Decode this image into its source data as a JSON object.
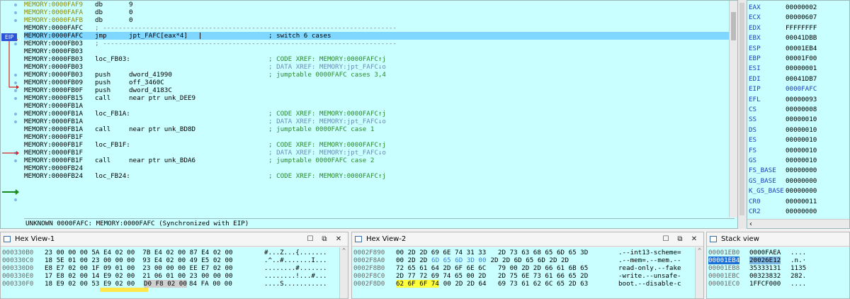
{
  "disasm": {
    "eip_tag": "EIP",
    "lines": [
      {
        "addr": "MEMORY:0000FAF9",
        "kind": "data",
        "mn": "db",
        "op": "9"
      },
      {
        "addr": "MEMORY:0000FAFA",
        "kind": "data",
        "mn": "db",
        "op": "0"
      },
      {
        "addr": "MEMORY:0000FAFB",
        "kind": "data",
        "mn": "db",
        "op": "0"
      },
      {
        "addr": "MEMORY:0000FAFC",
        "kind": "sep",
        "op": "; ---------------------------------------------------------------------------"
      },
      {
        "addr": "MEMORY:0000FAFC",
        "kind": "current",
        "mn": "jmp",
        "op": "jpt_FAFC[eax*4]",
        "cm": "; switch 6 cases",
        "cmkind": "plain"
      },
      {
        "addr": "MEMORY:0000FB03",
        "kind": "sep",
        "op": "; ---------------------------------------------------------------------------"
      },
      {
        "addr": "MEMORY:0000FB03",
        "kind": "blank"
      },
      {
        "addr": "MEMORY:0000FB03",
        "kind": "label",
        "label": "loc_FB03:",
        "cm": "; CODE XREF: MEMORY:0000FAFC↑j",
        "cmkind": "code"
      },
      {
        "addr": "MEMORY:0000FB03",
        "kind": "blank",
        "cm": "; DATA XREF: MEMORY:jpt_FAFC↓o",
        "cmkind": "data"
      },
      {
        "addr": "MEMORY:0000FB03",
        "kind": "ins",
        "mn": "push",
        "op": "dword_41990",
        "cm": "; jumptable 0000FAFC cases 3,4",
        "cmkind": "green"
      },
      {
        "addr": "MEMORY:0000FB09",
        "kind": "ins",
        "mn": "push",
        "op": "off_3460C"
      },
      {
        "addr": "MEMORY:0000FB0F",
        "kind": "ins",
        "mn": "push",
        "op": "dword_4183C"
      },
      {
        "addr": "MEMORY:0000FB15",
        "kind": "ins",
        "mn": "call",
        "op": "near ptr unk_DEE9"
      },
      {
        "addr": "MEMORY:0000FB1A",
        "kind": "blank"
      },
      {
        "addr": "MEMORY:0000FB1A",
        "kind": "label",
        "label": "loc_FB1A:",
        "cm": "; CODE XREF: MEMORY:0000FAFC↑j",
        "cmkind": "code"
      },
      {
        "addr": "MEMORY:0000FB1A",
        "kind": "blank",
        "cm": "; DATA XREF: MEMORY:jpt_FAFC↓o",
        "cmkind": "data"
      },
      {
        "addr": "MEMORY:0000FB1A",
        "kind": "ins",
        "mn": "call",
        "op": "near ptr unk_BD8D",
        "cm": "; jumptable 0000FAFC case 1",
        "cmkind": "green"
      },
      {
        "addr": "MEMORY:0000FB1F",
        "kind": "blank"
      },
      {
        "addr": "MEMORY:0000FB1F",
        "kind": "label",
        "label": "loc_FB1F:",
        "cm": "; CODE XREF: MEMORY:0000FAFC↑j",
        "cmkind": "code"
      },
      {
        "addr": "MEMORY:0000FB1F",
        "kind": "blank",
        "cm": "; DATA XREF: MEMORY:jpt_FAFC↓o",
        "cmkind": "data"
      },
      {
        "addr": "MEMORY:0000FB1F",
        "kind": "ins",
        "mn": "call",
        "op": "near ptr unk_BDA6",
        "cm": "; jumptable 0000FAFC case 2",
        "cmkind": "green"
      },
      {
        "addr": "MEMORY:0000FB24",
        "kind": "blank"
      },
      {
        "addr": "MEMORY:0000FB24",
        "kind": "label",
        "label": "loc_FB24:",
        "cm": "; CODE XREF: MEMORY:0000FAFC↑j",
        "cmkind": "code"
      }
    ],
    "status": "UNKNOWN 0000FAFC: MEMORY:0000FAFC (Synchronized with EIP)"
  },
  "registers": [
    {
      "name": "EAX",
      "value": "00000002",
      "changed": false
    },
    {
      "name": "ECX",
      "value": "00000607",
      "changed": false
    },
    {
      "name": "EDX",
      "value": "FFFFFFFF",
      "changed": false
    },
    {
      "name": "EBX",
      "value": "00041DBB",
      "changed": false
    },
    {
      "name": "ESP",
      "value": "00001EB4",
      "changed": false
    },
    {
      "name": "EBP",
      "value": "00001F00",
      "changed": false
    },
    {
      "name": "ESI",
      "value": "00000001",
      "changed": false
    },
    {
      "name": "EDI",
      "value": "00041DB7",
      "changed": false
    },
    {
      "name": "EIP",
      "value": "0000FAFC",
      "changed": true
    },
    {
      "name": "EFL",
      "value": "00000093",
      "changed": false
    },
    {
      "name": "CS",
      "value": "00000008",
      "changed": false
    },
    {
      "name": "SS",
      "value": "00000010",
      "changed": false
    },
    {
      "name": "DS",
      "value": "00000010",
      "changed": false
    },
    {
      "name": "ES",
      "value": "00000010",
      "changed": false
    },
    {
      "name": "FS",
      "value": "00000010",
      "changed": false
    },
    {
      "name": "GS",
      "value": "00000010",
      "changed": false
    },
    {
      "name": "FS_BASE",
      "value": "00000000",
      "changed": false
    },
    {
      "name": "GS_BASE",
      "value": "00000000",
      "changed": false
    },
    {
      "name": "K_GS_BASE",
      "value": "00000000",
      "changed": false
    },
    {
      "name": "CR0",
      "value": "00000011",
      "changed": false
    },
    {
      "name": "CR2",
      "value": "00000000",
      "changed": false
    }
  ],
  "hex1": {
    "title": "Hex View-1",
    "rows": [
      {
        "addr": "000330B0",
        "bytes": "23 00 00 00 5A E4 02 00  7B E4 02 00 87 E4 02 00",
        "ascii": "#...Z...{......."
      },
      {
        "addr": "000330C0",
        "bytes": "18 5E 01 00 23 00 00 00  93 E4 02 00 49 E5 02 00",
        "ascii": ".^..#.......I..."
      },
      {
        "addr": "000330D0",
        "bytes": "E8 E7 02 00 1F 09 01 00  23 00 00 00 EE E7 02 00",
        "ascii": "........#......."
      },
      {
        "addr": "000330E0",
        "bytes": "17 E8 02 00 14 E9 02 00  21 06 01 00 23 00 00 00",
        "ascii": "........!...#..."
      },
      {
        "addr": "000330F0",
        "bytes_a": "18 E9 02 00 53 E9 02 00",
        "bytes_b": "D0 F8 02 00",
        "bytes_c": "84 FA 00 00",
        "ascii": "....S..........."
      }
    ]
  },
  "hex2": {
    "title": "Hex View-2",
    "rows": [
      {
        "addr": "0002F890",
        "bytes_a": "00 2D 2D 69 6E 74 31 33",
        "bytes_b": "2D 73 63 68 65 6D 65 3D",
        "ascii": ".--int13-scheme="
      },
      {
        "addr": "0002F8A0",
        "bytes_a": "00 2D 2D",
        "bytes_hl": "6D 65 6D 3D 00",
        "bytes_b": "2D 2D 6D 65 6D 2D 2D",
        "ascii": ".--mem=.--mem.--"
      },
      {
        "addr": "0002F8B0",
        "bytes_a": "72 65 61 64 2D 6F 6E 6C",
        "bytes_b": "79 00 2D 2D 66 61 6B 65",
        "ascii": "read-only.--fake"
      },
      {
        "addr": "0002F8C0",
        "bytes_a": "2D 77 72 69 74 65 00 2D",
        "bytes_b": "2D 75 6E 73 61 66 65 2D",
        "ascii": "-write.--unsafe-"
      },
      {
        "addr": "0002F8D0",
        "bytes_y": "62 6F 6F 74",
        "bytes_a": "00 2D 2D 64",
        "bytes_b": "69 73 61 62 6C 65 2D 63",
        "ascii": "boot.--disable-c"
      }
    ]
  },
  "stack": {
    "title": "Stack view",
    "rows": [
      {
        "addr": "00001EB0",
        "value": "0000FAEA",
        "ascii": "....",
        "selected": false
      },
      {
        "addr": "00001EB4",
        "value": "20026E12",
        "ascii": ".n.·",
        "selected": true
      },
      {
        "addr": "00001EB8",
        "value": "35333131",
        "ascii": "1135",
        "selected": false
      },
      {
        "addr": "00001EBC",
        "value": "00323832",
        "ascii": "282.",
        "selected": false
      },
      {
        "addr": "00001EC0",
        "value": "1FFCF000",
        "ascii": "....",
        "selected": false
      }
    ]
  }
}
